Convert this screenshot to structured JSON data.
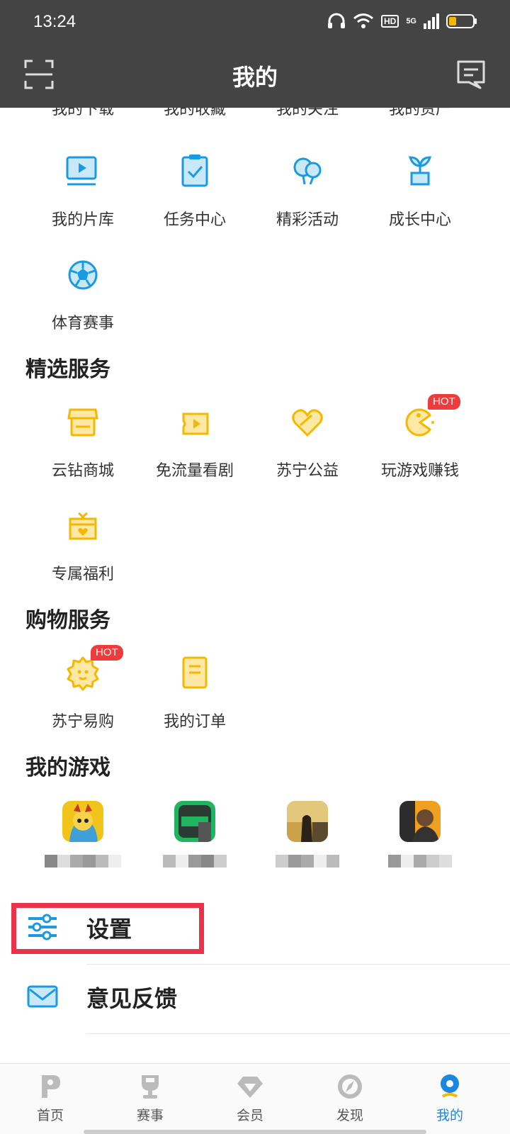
{
  "status": {
    "time": "13:24",
    "hd": "HD",
    "net": "5G"
  },
  "header": {
    "title": "我的"
  },
  "cut_row": [
    "我的下载",
    "我的收藏",
    "我的关注",
    "我的资产"
  ],
  "grid1": [
    {
      "label": "我的片库",
      "icon": "video-library-icon"
    },
    {
      "label": "任务中心",
      "icon": "task-clipboard-icon"
    },
    {
      "label": "精彩活动",
      "icon": "balloons-icon"
    },
    {
      "label": "成长中心",
      "icon": "sprout-icon"
    },
    {
      "label": "体育赛事",
      "icon": "soccer-ball-icon"
    }
  ],
  "section_featured": "精选服务",
  "grid2": [
    {
      "label": "云钻商城",
      "icon": "store-icon"
    },
    {
      "label": "免流量看剧",
      "icon": "ticket-play-icon"
    },
    {
      "label": "苏宁公益",
      "icon": "heart-hands-icon"
    },
    {
      "label": "玩游戏赚钱",
      "icon": "pacman-icon",
      "badge": "HOT"
    },
    {
      "label": "专属福利",
      "icon": "gift-box-icon"
    }
  ],
  "section_shopping": "购物服务",
  "grid3": [
    {
      "label": "苏宁易购",
      "icon": "lion-icon",
      "badge": "HOT"
    },
    {
      "label": "我的订单",
      "icon": "order-doc-icon"
    }
  ],
  "section_games": "我的游戏",
  "menu": {
    "settings": "设置",
    "feedback": "意见反馈"
  },
  "tabs": [
    {
      "label": "首页",
      "icon": "home-icon"
    },
    {
      "label": "赛事",
      "icon": "trophy-icon"
    },
    {
      "label": "会员",
      "icon": "diamond-icon"
    },
    {
      "label": "发现",
      "icon": "compass-icon"
    },
    {
      "label": "我的",
      "icon": "profile-icon",
      "active": true
    }
  ],
  "colors": {
    "blue": "#1a9ae0",
    "yellow": "#f5b800",
    "red": "#e8344a",
    "header": "#444444"
  }
}
